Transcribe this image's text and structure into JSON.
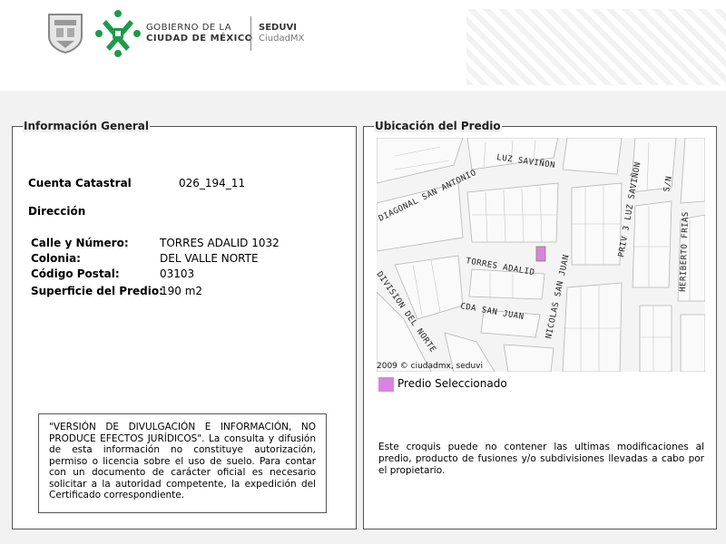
{
  "header": {
    "gov_line1": "GOBIERNO DE LA",
    "gov_line2": "CIUDAD DE MÉXICO",
    "agency_line1": "SEDUVI",
    "agency_line2": "CiudadMX"
  },
  "general": {
    "title": "Información General",
    "cuenta_label": "Cuenta Catastral",
    "cuenta_value": "026_194_11",
    "direccion_label": "Dirección",
    "calle_label": "Calle y Número:",
    "calle_value": "TORRES ADALID 1032",
    "colonia_label": "Colonia:",
    "colonia_value": "DEL VALLE NORTE",
    "cp_label": "Código Postal:",
    "cp_value": "03103",
    "superficie_label": "Superficie del Predio:",
    "superficie_value": "190 m2",
    "disclaimer": "\"VERSIÓN DE DIVULGACIÓN E INFORMACIÓN, NO PRODUCE EFECTOS JURÍDICOS\". La consulta y difusión de esta información no constituye autorización, permiso o licencia sobre el uso de suelo. Para contar con un documento de carácter oficial es necesario solicitar a la autoridad competente, la expedición del Certificado correspondiente."
  },
  "location": {
    "title": "Ubicación del Predio",
    "streets": {
      "luz_savinon": "LUZ SAVIÑON",
      "diagonal_san_antonio": "DIAGONAL SAN ANTONIO",
      "torres_adalid": "TORRES ADALID",
      "cda_san_juan": "CDA SAN JUAN",
      "nicolas_san_juan": "NICOLAS SAN JUAN",
      "division_del_norte": "DIVISION DEL NORTE",
      "priv_luz_savinon": "PRIV 3 LUZ SAVIÑON",
      "heriberto_frias": "HERIBERTO FRIAS",
      "sn": "S/N"
    },
    "copyright": "2009 © ciudadmx, seduvi",
    "legend_label": "Predio Seleccionado",
    "legend_color": "#d884e0",
    "note": "Este croquis puede no contener las ultimas modificaciones al predio, producto de fusiones y/o subdivisiones llevadas a cabo por el propietario."
  }
}
